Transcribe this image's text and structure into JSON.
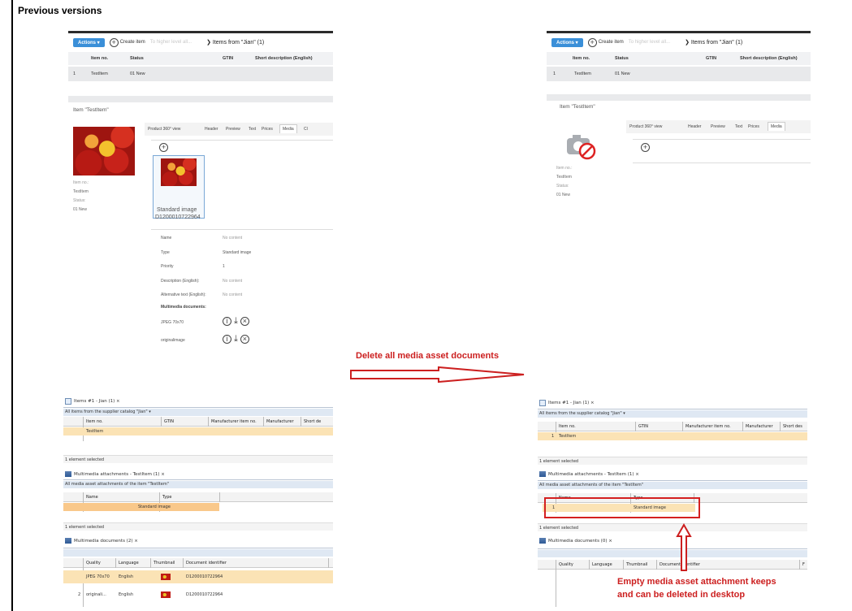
{
  "page": {
    "title": "Previous versions"
  },
  "web_before": {
    "toolbar": {
      "actions": "Actions ▾",
      "create_item": "Create item",
      "to_higher_level": "To higher level all...",
      "breadcrumb": "Items from \"Jian\" (1)"
    },
    "table": {
      "headers": [
        "Item no.",
        "Status",
        "GTIN",
        "Short description (English)"
      ],
      "row": {
        "index": "1",
        "item_no": "TestItem",
        "status": "01 New"
      }
    },
    "detail": {
      "title": "Item \"TestItem\"",
      "tabs": [
        "Product 360° view",
        "Header",
        "Preview",
        "Text",
        "Prices",
        "Media",
        "Cl"
      ],
      "meta": [
        "Item no.:",
        "TestItem",
        "Status:",
        "01 New"
      ],
      "media_card": {
        "label": "Standard image",
        "id": "D1200010722964"
      },
      "fields": [
        {
          "label": "Name",
          "value": "No content"
        },
        {
          "label": "Type",
          "value": "Standard image"
        },
        {
          "label": "Priority",
          "value": "1"
        },
        {
          "label": "Description (English):",
          "value": "No content"
        },
        {
          "label": "Alternative text (English):",
          "value": "No content"
        }
      ],
      "multimedia_heading": "Multimedia documents:",
      "documents": [
        "JPEG 70x70",
        "originalimage"
      ]
    }
  },
  "web_after": {
    "toolbar": {
      "actions": "Actions ▾",
      "create_item": "Create item",
      "to_higher_level": "To higher level all...",
      "breadcrumb": "Items from \"Jian\" (1)"
    },
    "table": {
      "headers": [
        "Item no.",
        "Status",
        "GTIN",
        "Short description (English)"
      ],
      "row": {
        "index": "1",
        "item_no": "TestItem",
        "status": "01 New"
      }
    },
    "detail": {
      "title": "Item \"TestItem\"",
      "tabs": [
        "Product 360° view",
        "Header",
        "Preview",
        "Text",
        "Prices",
        "Media"
      ],
      "meta": [
        "Item no.:",
        "TestItem",
        "Status:",
        "01 New"
      ]
    }
  },
  "annotation": {
    "delete_all": "Delete all media asset documents",
    "empty_note_line1": "Empty media asset attachment keeps",
    "empty_note_line2": "and can be deleted in desktop"
  },
  "desktop_before": {
    "items_tab": "Items #1 - Jian (1) ⨯",
    "items_filter": "All items from the supplier catalog \"Jian\"  ▾",
    "items_headers": [
      "Item no.",
      "GTIN",
      "Manufacturer item no.",
      "Manufacturer",
      "Short de"
    ],
    "items_row": "TestItem",
    "status1": "1 element selected",
    "mm_tab": "Multimedia attachments - TestItem (1) ⨯",
    "mm_filter": "All media asset attachments of the item \"TestItem\"",
    "mm_headers": [
      "Name",
      "Type"
    ],
    "mm_row_type": "Standard image",
    "status2": "1 element selected",
    "docs_tab": "Multimedia documents (2) ⨯",
    "docs_headers": [
      "Quality",
      "Language",
      "Thumbnail",
      "Document identifier"
    ],
    "docs_rows": [
      {
        "idx": "",
        "quality": "JPEG 70x70",
        "language": "English",
        "doc_id": "D1200010722964"
      },
      {
        "idx": "2",
        "quality": "originali...",
        "language": "English",
        "doc_id": "D1200010722964"
      }
    ]
  },
  "desktop_after": {
    "items_tab": "Items #1 - Jian (1) ⨯",
    "items_filter": "All items from the supplier catalog \"Jian\"  ▾",
    "items_headers": [
      "Item no.",
      "GTIN",
      "Manufacturer item no.",
      "Manufacturer",
      "Short des"
    ],
    "items_row_idx": "1",
    "items_row": "TestItem",
    "status1": "1 element selected",
    "mm_tab": "Multimedia attachments - TestItem (1) ⨯",
    "mm_filter": "All media asset attachments of the item \"TestItem\"",
    "mm_headers": [
      "Name",
      "Type"
    ],
    "mm_row_idx": "1",
    "mm_row_type": "Standard image",
    "status2": "1 element selected",
    "docs_tab": "Multimedia documents (0) ⨯",
    "docs_headers": [
      "Quality",
      "Language",
      "Thumbnail",
      "Document identifier",
      "F"
    ]
  },
  "colors": {
    "actions_blue": "#3a8fd8",
    "annotation_red": "#cc1f1f",
    "selected_row": "#fbe3b5",
    "filter_bar": "#dfe8f3"
  }
}
